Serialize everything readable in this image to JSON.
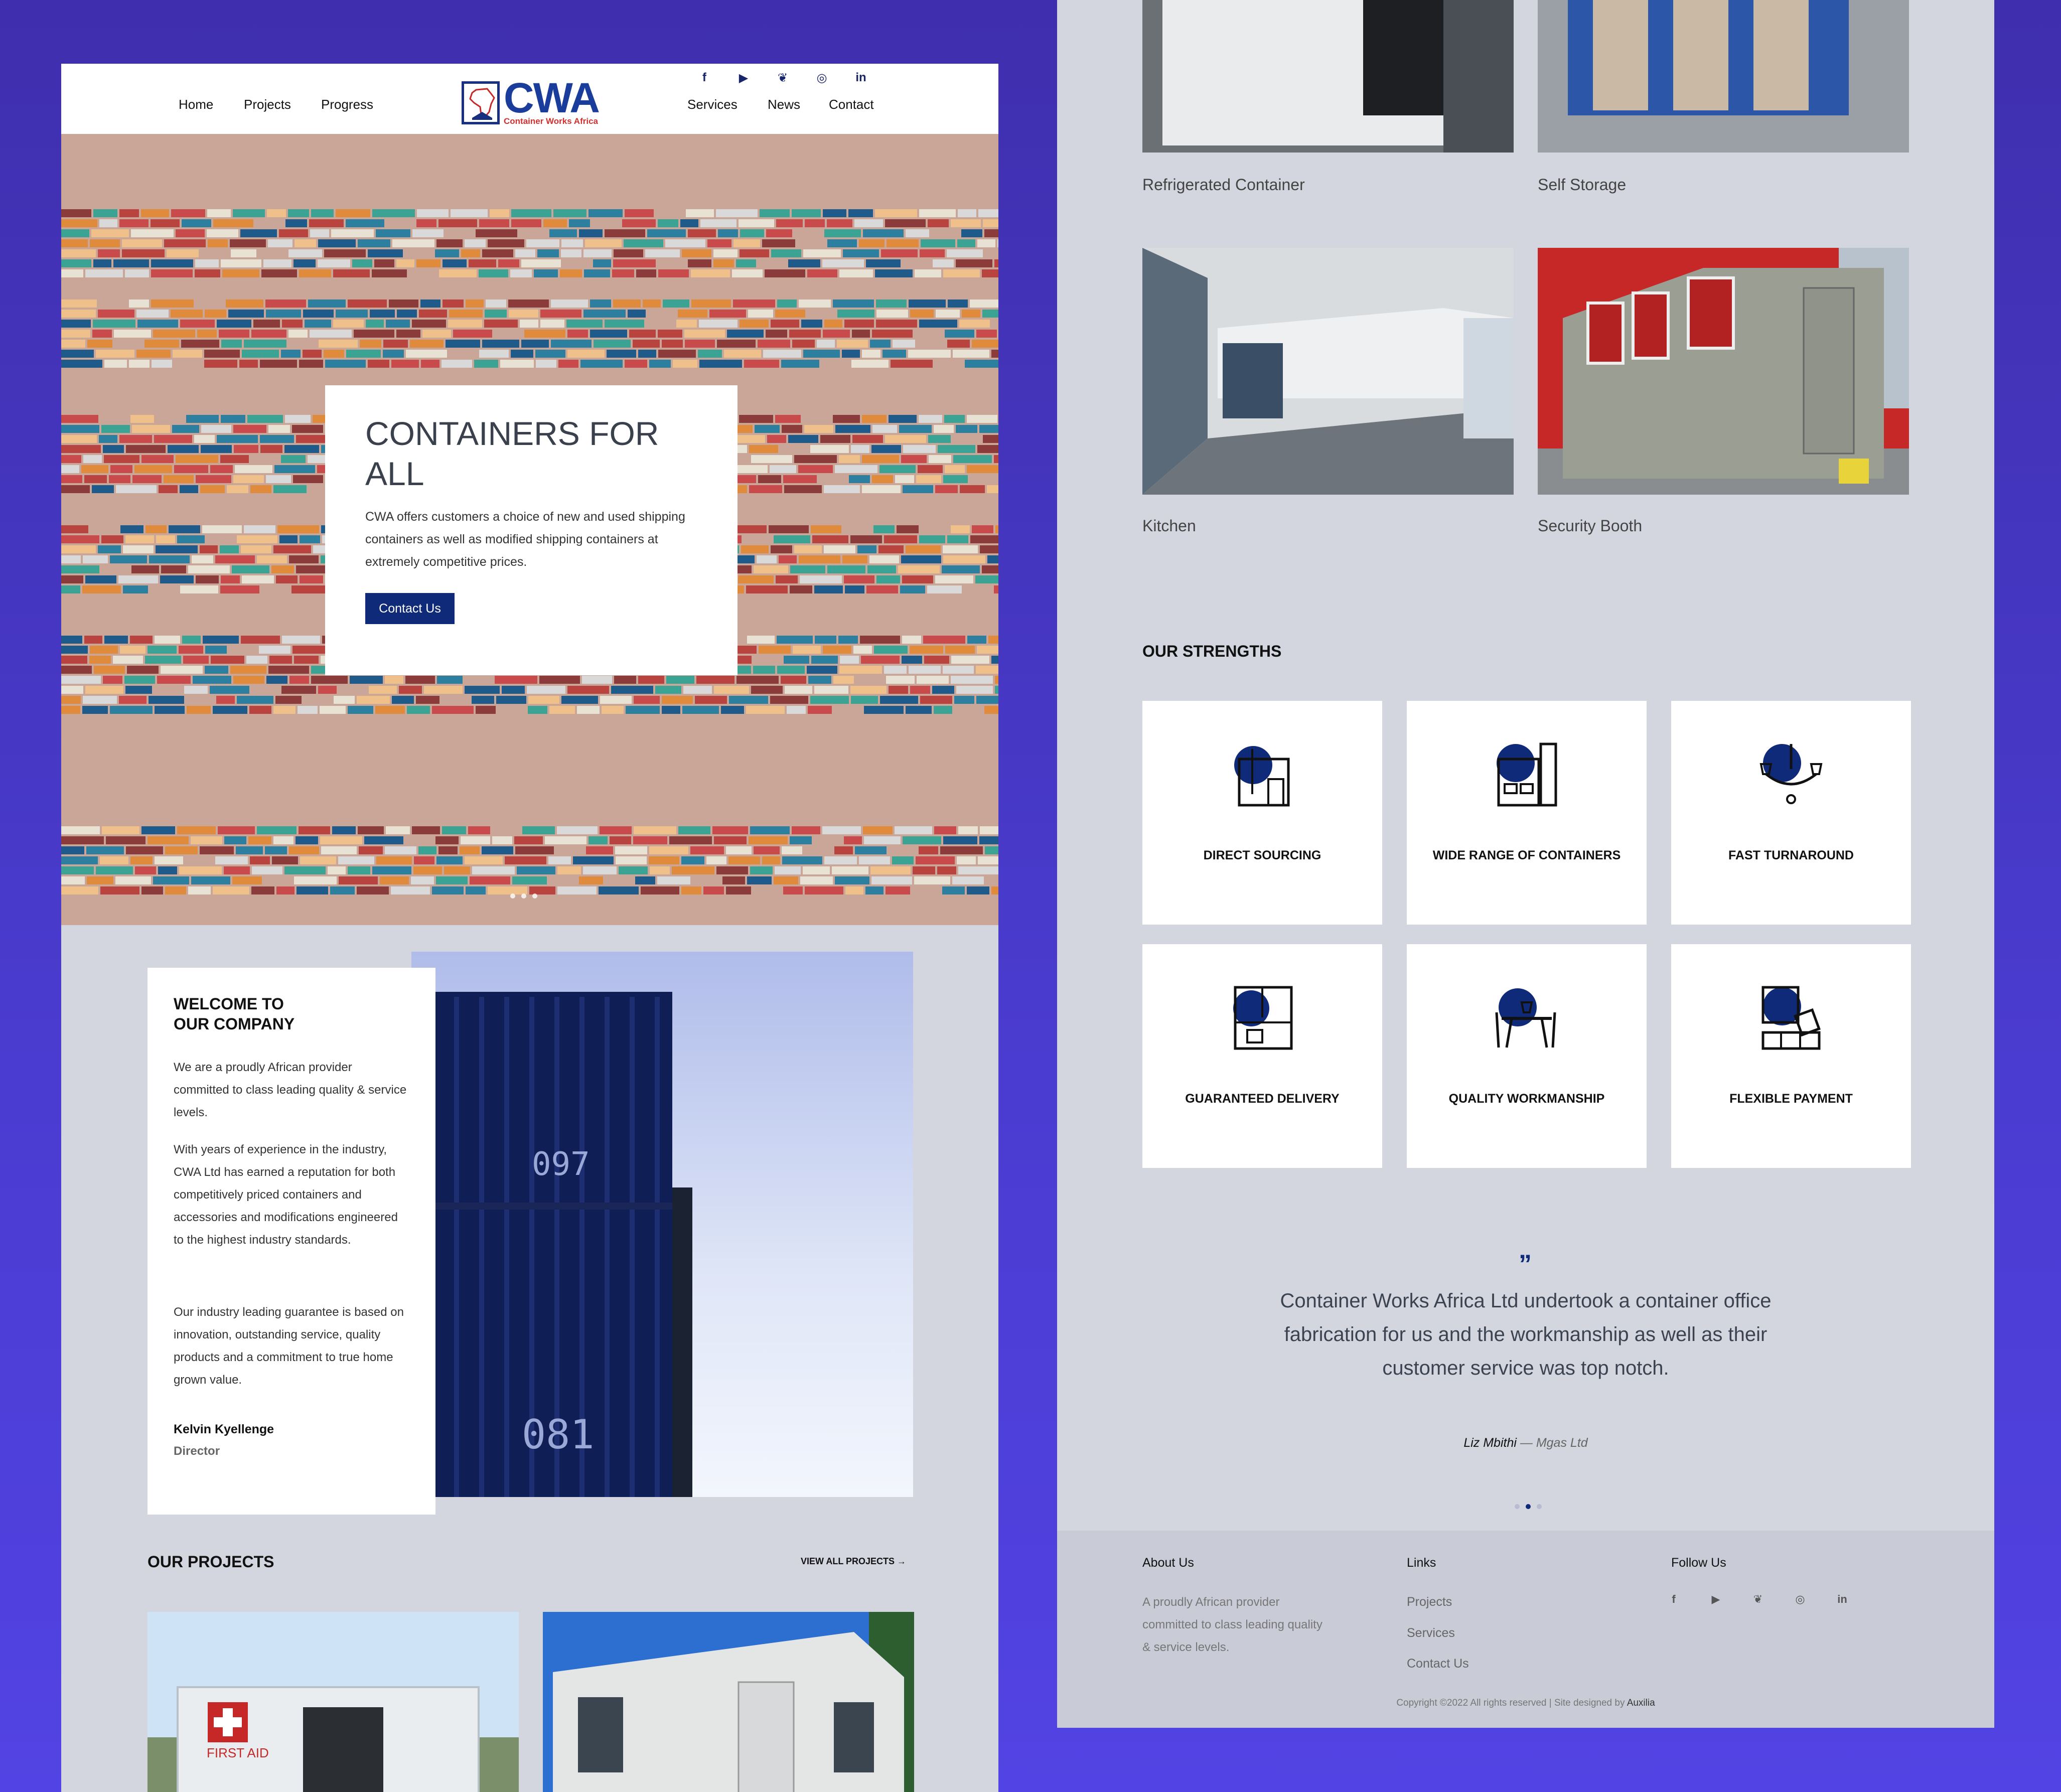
{
  "nav": {
    "left": [
      "Home",
      "Projects",
      "Progress"
    ],
    "right": [
      "Services",
      "News",
      "Contact"
    ],
    "social": [
      "f",
      "▶",
      "🐦",
      "◎",
      "in"
    ],
    "logo_text": "CWA",
    "logo_sub": "Container Works Africa"
  },
  "hero": {
    "title": "CONTAINERS FOR ALL",
    "text": "CWA offers customers a choice of new and used shipping containers as well as modified shipping containers at extremely competitive prices.",
    "button": "Contact Us"
  },
  "welcome": {
    "title_line1": "WELCOME TO",
    "title_line2": "OUR COMPANY",
    "p1": "We are a proudly African provider committed to class leading quality & service levels.",
    "p2": "With years of experience in the industry, CWA Ltd has earned a reputation for both competitively priced containers and accessories and modifications engineered to the highest industry standards.",
    "p3": "Our industry leading guarantee is based on innovation, outstanding service, quality products and a commitment to true home grown value.",
    "name": "Kelvin Kyellenge",
    "role": "Director",
    "container_codes": [
      "097",
      "081"
    ]
  },
  "projects": {
    "heading": "OUR PROJECTS",
    "view_all": "VIEW ALL PROJECTS →",
    "first_aid": "FIRST AID"
  },
  "services": [
    {
      "caption": "Refrigerated Container"
    },
    {
      "caption": "Self Storage"
    },
    {
      "caption": "Kitchen"
    },
    {
      "caption": "Security Booth"
    }
  ],
  "strengths": {
    "heading": "OUR STRENGTHS",
    "items": [
      {
        "label": "DIRECT SOURCING",
        "icon": "door-room-icon"
      },
      {
        "label": "WIDE RANGE OF CONTAINERS",
        "icon": "wardrobe-icon"
      },
      {
        "label": "FAST TURNAROUND",
        "icon": "chandelier-icon"
      },
      {
        "label": "GUARANTEED DELIVERY",
        "icon": "floorplan-icon"
      },
      {
        "label": "QUALITY WORKMANSHIP",
        "icon": "dining-table-icon"
      },
      {
        "label": "FLEXIBLE PAYMENT",
        "icon": "boxes-icon"
      }
    ]
  },
  "testimonial": {
    "quote": "Container Works Africa Ltd undertook a container office fabrication for us and the workmanship as well as their customer service was top notch.",
    "author": "Liz Mbithi",
    "company": "— Mgas Ltd"
  },
  "footer": {
    "about_h": "About Us",
    "about_t": "A proudly African provider committed to class leading quality & service levels.",
    "links_h": "Links",
    "links": [
      "Projects",
      "Services",
      "Contact Us"
    ],
    "follow_h": "Follow Us",
    "social": [
      "f",
      "▶",
      "🐦",
      "◎",
      "in"
    ],
    "copyright": "Copyright ©2022 All rights reserved | Site designed by",
    "designer": "Auxilia"
  },
  "colors": {
    "brand": "#0f2a78",
    "logo_red": "#d32f2f",
    "page_bg": "#d3d5df",
    "backdrop": "#4a3cd0"
  }
}
